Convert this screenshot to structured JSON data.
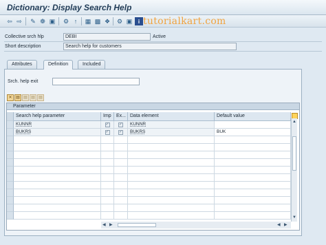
{
  "window": {
    "title": "Dictionary: Display Search Help"
  },
  "watermark": "tutorialkart.com",
  "header_fields": {
    "collective_label": "Collective srch hlp",
    "collective_value": "DEBI",
    "status": "Active",
    "short_desc_label": "Short description",
    "short_desc_value": "Search help for customers"
  },
  "tabs": [
    {
      "label": "Attributes",
      "active": false
    },
    {
      "label": "Definition",
      "active": true
    },
    {
      "label": "Included search helps",
      "active": false
    }
  ],
  "definition": {
    "srch_exit_label": "Srch. help exit",
    "srch_exit_value": ""
  },
  "grid": {
    "title": "Parameter",
    "columns": [
      "Search help parameter",
      "Imp",
      "Ex...",
      "Data element",
      "Default value"
    ],
    "rows": [
      {
        "param": "KUNNR",
        "imp": true,
        "exp": true,
        "data_element": "KUNNR",
        "default": ""
      },
      {
        "param": "BUKRS",
        "imp": true,
        "exp": true,
        "data_element": "BUKRS",
        "default": "BUK"
      }
    ]
  },
  "icons": {
    "toolbar": [
      "back-arrow-icon",
      "forward-arrow-icon",
      "toggle-display-change-icon",
      "other-object-icon",
      "check-icon",
      "activate-icon",
      "where-used-icon",
      "display-object-list-icon",
      "navigation-window-icon",
      "hierarchy-icon",
      "test-icon",
      "info-icon"
    ],
    "grid_toolbar": [
      "delete-row-icon",
      "copy-icon",
      "paste-icon",
      "insert-row-icon",
      "move-icon"
    ]
  },
  "colors": {
    "accent": "#2d5f8a",
    "watermark": "#f0a340",
    "background": "#dfe9f2"
  }
}
